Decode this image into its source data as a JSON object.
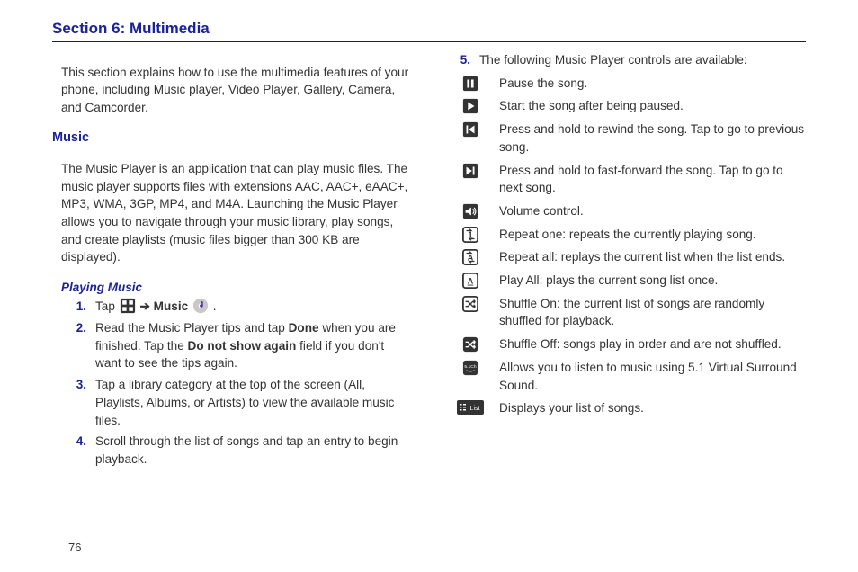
{
  "page": {
    "number": "76"
  },
  "section": {
    "title": "Section 6: Multimedia"
  },
  "left": {
    "intro": "This section explains how to use the multimedia features of your phone, including Music player, Video Player, Gallery, Camera, and Camcorder.",
    "music_heading": "Music",
    "music_body": "The Music Player is an application that can play music files. The music player supports files with extensions AAC, AAC+, eAAC+, MP3, WMA, 3GP, MP4, and M4A. Launching the Music Player allows you to navigate through your music library, play songs, and create playlists (music files bigger than 300 KB are displayed).",
    "playing_heading": "Playing Music",
    "steps": [
      {
        "num": "1.",
        "pre": "Tap ",
        "arrow": " ➔ ",
        "music_label": "Music",
        "post": " ."
      },
      {
        "num": "2.",
        "text_a": "Read the Music Player tips and tap ",
        "bold_a": "Done",
        "text_b": " when you are finished. Tap the ",
        "bold_b": "Do not show again",
        "text_c": " field if you don't want to see the tips again."
      },
      {
        "num": "3.",
        "text": "Tap a library category at the top of the screen (All, Playlists, Albums, or Artists) to view the available music files."
      },
      {
        "num": "4.",
        "text": "Scroll through the list of songs and tap an entry to begin playback."
      }
    ]
  },
  "right": {
    "step5": {
      "num": "5.",
      "text": "The following Music Player controls are available:"
    },
    "controls": [
      {
        "icon": "pause",
        "text": "Pause the song."
      },
      {
        "icon": "play",
        "text": "Start the song after being paused."
      },
      {
        "icon": "prev",
        "text": "Press and hold to rewind the song. Tap to go to previous song."
      },
      {
        "icon": "next",
        "text": "Press and hold to fast-forward  the song. Tap to go to next song."
      },
      {
        "icon": "volume",
        "text": "Volume control."
      },
      {
        "icon": "repeat1",
        "text": "Repeat one: repeats the currently playing song."
      },
      {
        "icon": "repeatA",
        "text": "Repeat all: replays the current list when the list ends."
      },
      {
        "icon": "playall",
        "text": "Play All: plays the current song list once."
      },
      {
        "icon": "shuffleOn",
        "text": "Shuffle On: the current list of songs are randomly shuffled for playback."
      },
      {
        "icon": "shuffleOff",
        "text": "Shuffle Off: songs play in order and are not shuffled."
      },
      {
        "icon": "surround",
        "text": "Allows you to listen to music using 5.1 Virtual Surround Sound."
      },
      {
        "icon": "list",
        "text": "Displays your list of songs."
      }
    ]
  }
}
